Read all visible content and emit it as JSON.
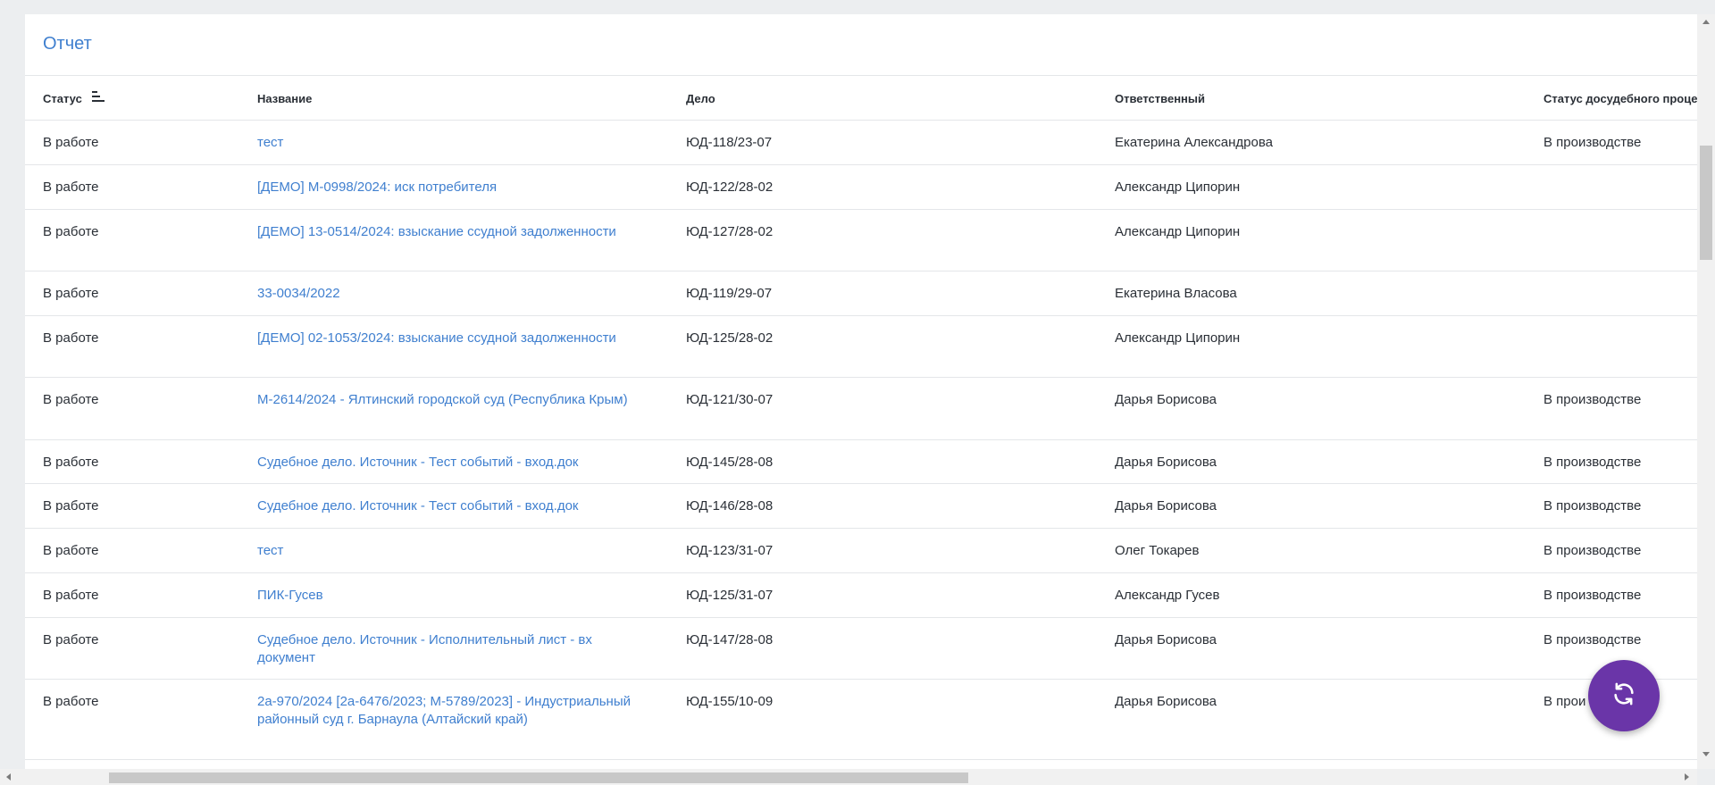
{
  "report": {
    "title": "Отчет",
    "columns": {
      "status": "Статус",
      "name": "Название",
      "case": "Дело",
      "responsible": "Ответственный",
      "pretrial": "Статус досудебного проце"
    },
    "rows": [
      {
        "status": "В работе",
        "name": "тест",
        "case": "ЮД-118/23-07",
        "responsible": "Екатерина Александрова",
        "pretrial": "В производстве"
      },
      {
        "status": "В работе",
        "name": "[ДЕМО] М-0998/2024: иск потребителя",
        "case": "ЮД-122/28-02",
        "responsible": "Александр Ципорин",
        "pretrial": ""
      },
      {
        "status": "В работе",
        "name": "[ДЕМО] 13-0514/2024: взыскание ссудной задолженности",
        "case": "ЮД-127/28-02",
        "responsible": "Александр Ципорин",
        "pretrial": ""
      },
      {
        "status": "В работе",
        "name": "33-0034/2022",
        "case": "ЮД-119/29-07",
        "responsible": "Екатерина Власова",
        "pretrial": ""
      },
      {
        "status": "В работе",
        "name": "[ДЕМО] 02-1053/2024: взыскание ссудной задолженности",
        "case": "ЮД-125/28-02",
        "responsible": "Александр Ципорин",
        "pretrial": ""
      },
      {
        "status": "В работе",
        "name": "М-2614/2024 - Ялтинский городской суд (Республика Крым)",
        "case": "ЮД-121/30-07",
        "responsible": "Дарья Борисова",
        "pretrial": "В производстве"
      },
      {
        "status": "В работе",
        "name": "Судебное дело. Источник - Тест событий - вход.док",
        "case": "ЮД-145/28-08",
        "responsible": "Дарья Борисова",
        "pretrial": "В производстве"
      },
      {
        "status": "В работе",
        "name": "Судебное дело. Источник - Тест событий - вход.док",
        "case": "ЮД-146/28-08",
        "responsible": "Дарья Борисова",
        "pretrial": "В производстве"
      },
      {
        "status": "В работе",
        "name": "тест",
        "case": "ЮД-123/31-07",
        "responsible": "Олег Токарев",
        "pretrial": "В производстве"
      },
      {
        "status": "В работе",
        "name": "ПИК-Гусев",
        "case": "ЮД-125/31-07",
        "responsible": "Александр Гусев",
        "pretrial": "В производстве"
      },
      {
        "status": "В работе",
        "name": "Судебное дело. Источник - Исполнительный лист - вх документ",
        "case": "ЮД-147/28-08",
        "responsible": "Дарья Борисова",
        "pretrial": "В производстве"
      },
      {
        "status": "В работе",
        "name": "2а-970/2024 [2а-6476/2023; М-5789/2023] - Индустриальный районный суд г. Барнаула (Алтайский край)",
        "case": "ЮД-155/10-09",
        "responsible": "Дарья Борисова",
        "pretrial": "В прои"
      }
    ]
  },
  "icons": {
    "sort": "sort-lines-icon",
    "refresh": "refresh-icon"
  },
  "colors": {
    "link": "#3f7fcf",
    "fab": "#6a35a8"
  }
}
